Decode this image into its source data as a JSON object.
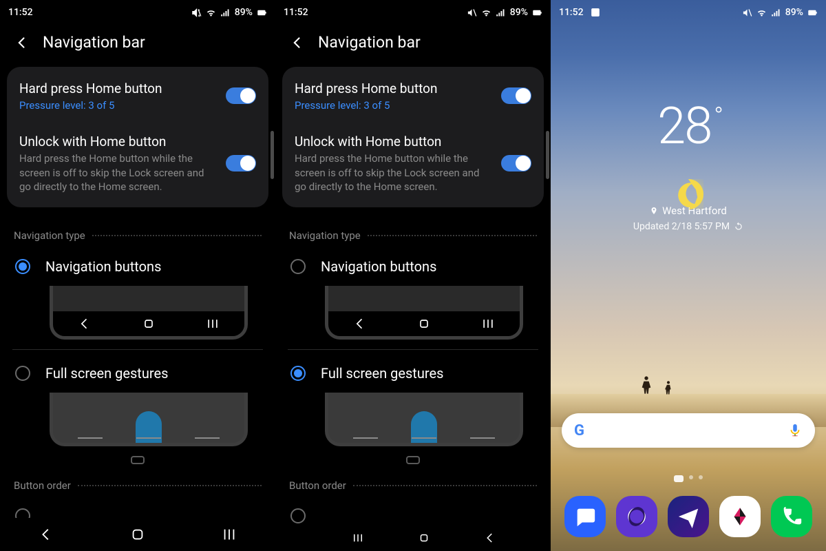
{
  "status": {
    "time": "11:52",
    "battery": "89%"
  },
  "settingsPage": {
    "title": "Navigation bar",
    "hardPress": {
      "title": "Hard press Home button",
      "sub": "Pressure level: 3 of 5",
      "on": true
    },
    "unlock": {
      "title": "Unlock with Home button",
      "sub": "Hard press the Home button while the screen is off to skip the Lock screen and go directly to the Home screen.",
      "on": true
    },
    "navTypeLabel": "Navigation type",
    "optNavButtons": "Navigation buttons",
    "optGestures": "Full screen gestures",
    "buttonOrderLabel": "Button order",
    "screen1Selected": "buttons",
    "screen2Selected": "gestures"
  },
  "homeScreen": {
    "temp": "28",
    "location": "West Hartford",
    "updated": "Updated 2/18 5:57 PM",
    "dock": [
      "messages",
      "internet",
      "send",
      "gallery",
      "phone"
    ]
  }
}
